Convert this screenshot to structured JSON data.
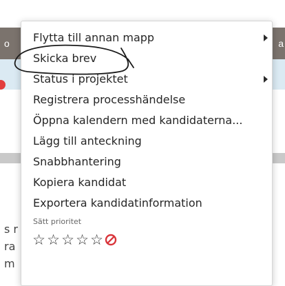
{
  "background": {
    "edge_left_glyph": "o",
    "edge_right_glyph": "a",
    "fragments": [
      "s r",
      "ra",
      "m"
    ]
  },
  "menu": {
    "items": [
      {
        "label": "Flytta till annan mapp",
        "submenu": true
      },
      {
        "label": "Skicka brev",
        "submenu": false
      },
      {
        "label": "Status i projektet",
        "submenu": true
      },
      {
        "label": "Registrera processhändelse",
        "submenu": false
      },
      {
        "label": "Öppna kalendern med kandidaterna...",
        "submenu": false
      },
      {
        "label": "Lägg till anteckning",
        "submenu": false
      },
      {
        "label": "Snabbhantering",
        "submenu": false
      },
      {
        "label": "Kopiera kandidat",
        "submenu": false
      },
      {
        "label": "Exportera kandidatinformation",
        "submenu": false
      }
    ],
    "priority": {
      "label": "Sätt prioritet",
      "stars": [
        "☆",
        "☆",
        "☆",
        "☆",
        "☆"
      ],
      "clear_icon": "no-entry-icon"
    }
  },
  "colors": {
    "header_band": "#7b736d",
    "selected_band": "#dbeaf3",
    "clear_priority": "#d9343a"
  }
}
